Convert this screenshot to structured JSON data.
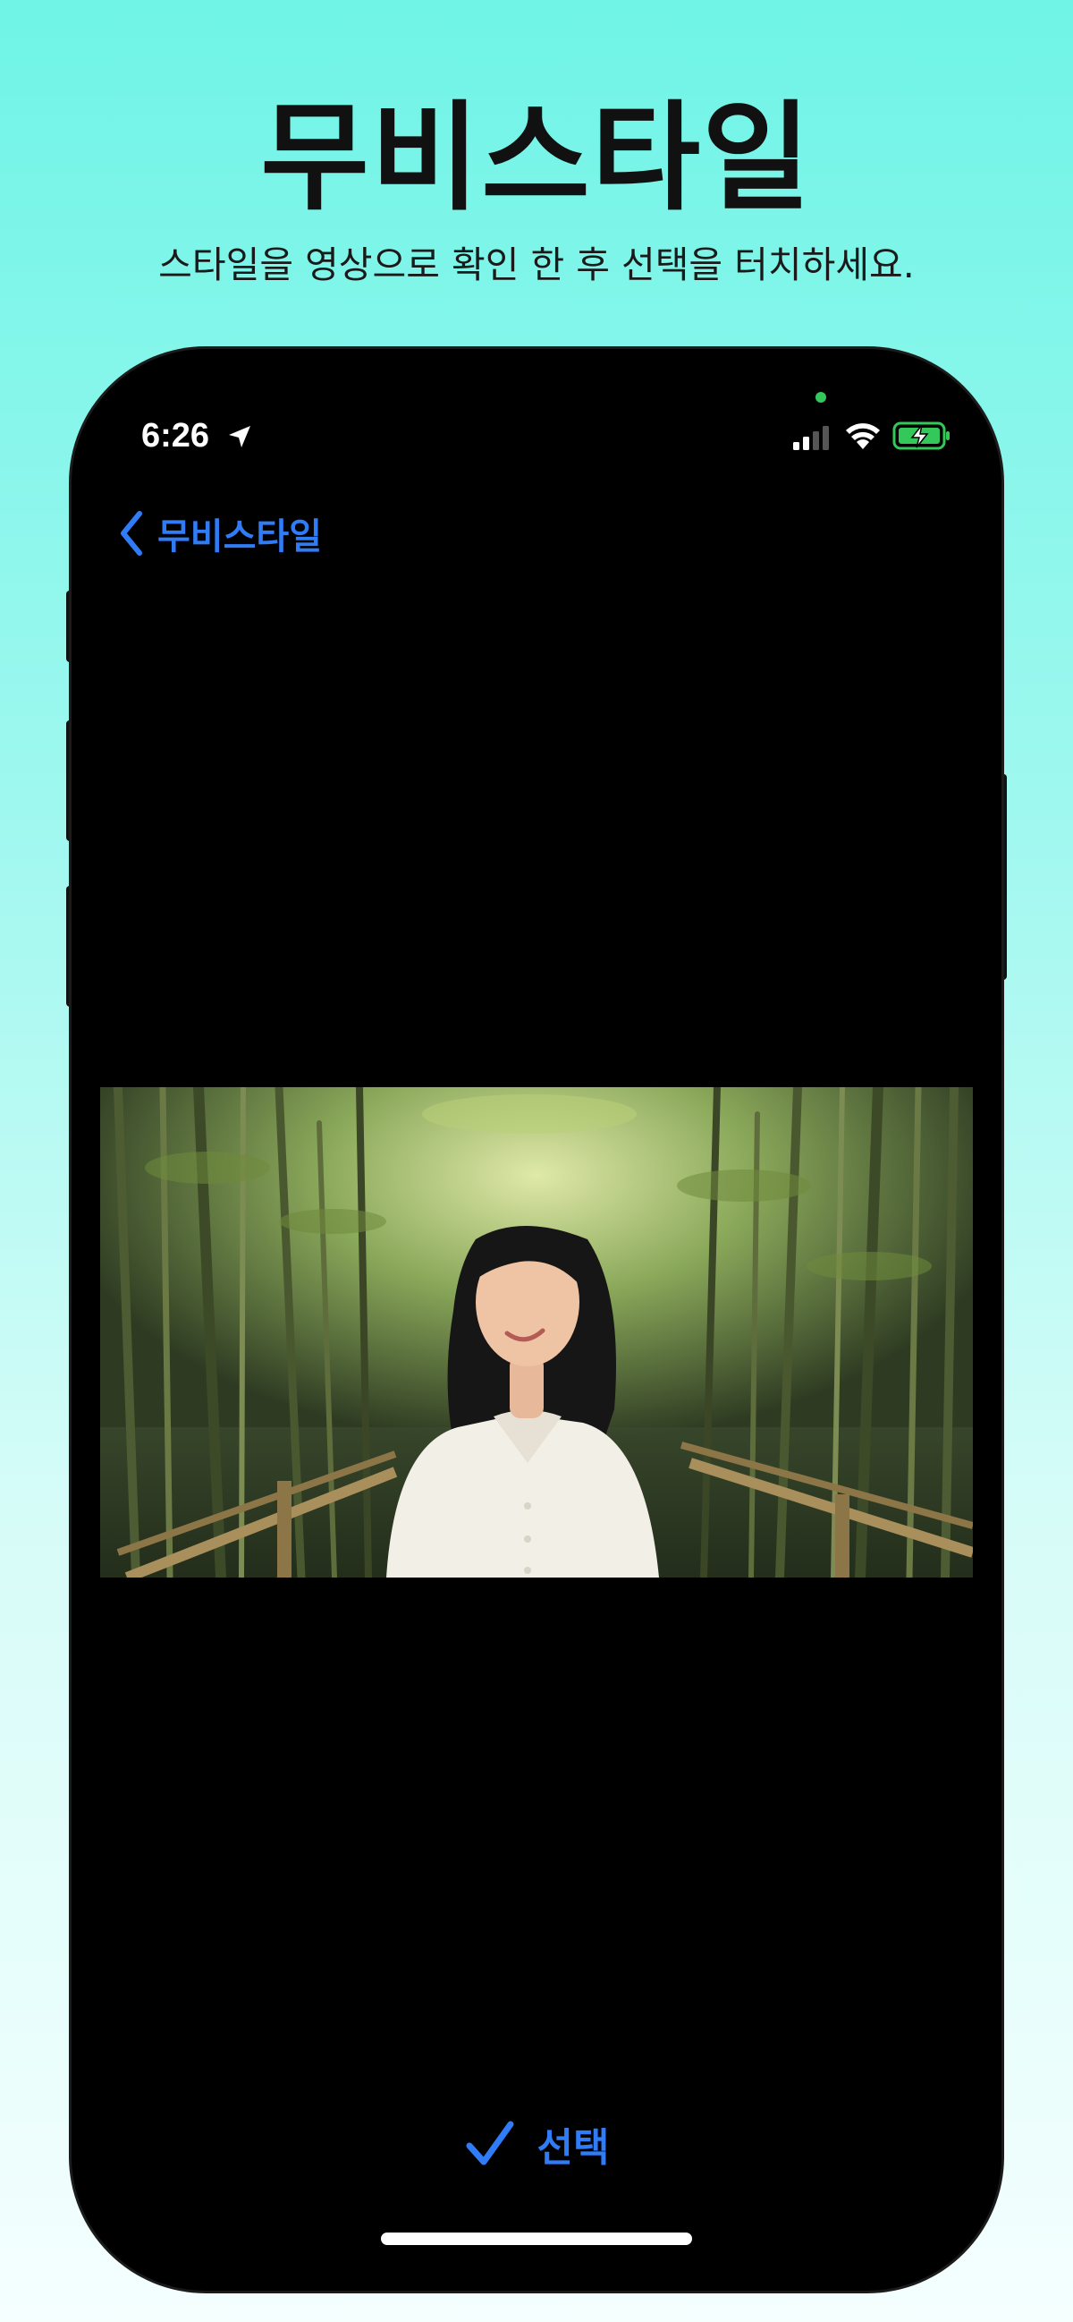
{
  "header": {
    "title": "무비스타일",
    "subtitle": "스타일을 영상으로 확인 한 후 선택을 터치하세요."
  },
  "status_bar": {
    "time": "6:26",
    "icons": [
      "location-arrow-icon",
      "signal-icon",
      "wifi-icon",
      "battery-charging-icon"
    ],
    "camera_indicator_color": "#34c759"
  },
  "nav": {
    "back_label": "무비스타일",
    "back_icon": "chevron-left-icon"
  },
  "video": {
    "description_icon": "video-preview"
  },
  "action": {
    "select_label": "선택",
    "icon": "checkmark-icon"
  },
  "colors": {
    "accent": "#2f7cf6",
    "phone_bg": "#000000",
    "battery_fill": "#34c759"
  }
}
